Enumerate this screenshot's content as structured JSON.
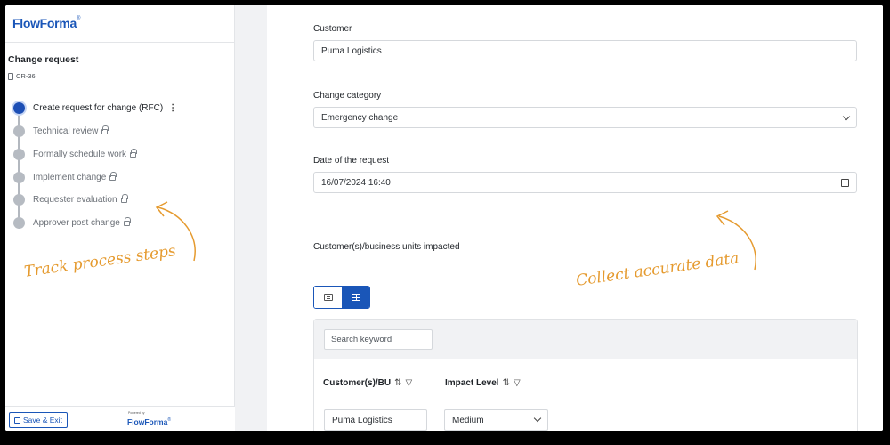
{
  "brand": {
    "logo_text": "FlowForma",
    "powered_by": "Powered by"
  },
  "request": {
    "title": "Change request",
    "id": "CR-36"
  },
  "steps": [
    {
      "label": "Create request for change (RFC)",
      "state": "active"
    },
    {
      "label": "Technical review",
      "state": "locked"
    },
    {
      "label": "Formally schedule work",
      "state": "locked"
    },
    {
      "label": "Implement change",
      "state": "locked"
    },
    {
      "label": "Requester evaluation",
      "state": "locked"
    },
    {
      "label": "Approver post change",
      "state": "locked"
    }
  ],
  "annotations": {
    "left": "Track process steps",
    "right": "Collect accurate data"
  },
  "footer": {
    "save_exit_label": "Save & Exit"
  },
  "form": {
    "customer": {
      "label": "Customer",
      "value": "Puma Logistics"
    },
    "change_category": {
      "label": "Change category",
      "value": "Emergency change"
    },
    "request_date": {
      "label": "Date of the request",
      "value": "16/07/2024 16:40"
    },
    "impacted": {
      "label": "Customer(s)/business units impacted",
      "search_placeholder": "Search keyword",
      "columns": [
        "Customer(s)/BU",
        "Impact Level"
      ],
      "rows": [
        {
          "bu": "Puma Logistics",
          "impact": "Medium"
        }
      ]
    }
  },
  "colors": {
    "accent": "#1a56b8",
    "annotation": "#e59a2e",
    "step_inactive": "#b6bbc2"
  }
}
